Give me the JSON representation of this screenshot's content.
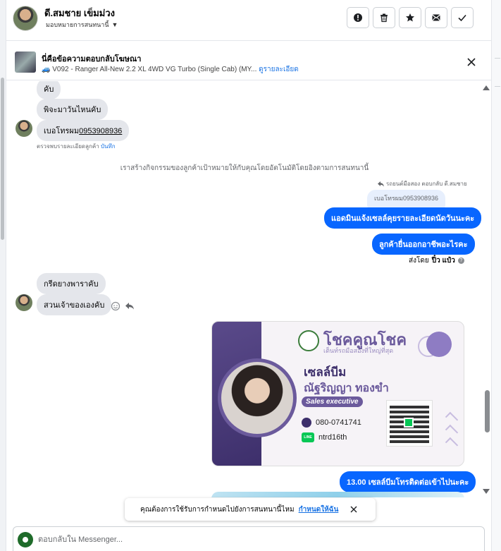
{
  "header": {
    "contact_name": "ดี.สมชาย เข็มม่วง",
    "assign_label": "มอบหมายการสนทนานี้",
    "actions": [
      "spam-icon",
      "trash-icon",
      "star-icon",
      "mark-unread-icon",
      "done-icon"
    ]
  },
  "ad_context": {
    "title": "นี่คือข้อความตอบกลับโฆษณา",
    "subtitle": "V092 - Ranger All-New 2.2 XL 4WD VG Turbo (Single Cab) (MY...",
    "details_link": "ดูรายละเอียด"
  },
  "thread": {
    "incoming": [
      {
        "text": "คับ"
      },
      {
        "text": "พิจะมาวันไหนคับ"
      },
      {
        "text_prefix": "เบอโทรผม",
        "phone": "0953908936"
      }
    ],
    "note": {
      "text": "ตรวจพบรายละเอียดลูกค้า",
      "link": "บันทึก"
    },
    "system_message": "เราสร้างกิจกรรมของลูกค้าเป้าหมายให้กับคุณโดยอัตโนมัติโดยอิงตามการสนทนานี้",
    "replied_note": "รถยนต์มือสอง ตอบกลับ ดี.สมชาย",
    "quoted_text": "เบอโทรผม0953908936",
    "outgoing": [
      {
        "text": "แอดมินแจ้งเซลล์คุยรายละเอียดนัดวันนะคะ"
      },
      {
        "text": "ลูกค้ายื่นออกอาชีพอะไรคะ"
      }
    ],
    "sent_by": {
      "prefix": "ส่งโดย",
      "name": "ปิ๋ว แป๋ว"
    },
    "incoming_2": [
      {
        "text": "กรีดยางพาราคับ"
      },
      {
        "text": "สวนเจ้าของเองคับ"
      }
    ],
    "card": {
      "brand": "โชคคูณโชค",
      "brand_sub": "เต็นท์รถมือสองที่ใหญ่ที่สุด",
      "nickname": "เซลล์บีม",
      "fullname": "ณัฐริญญา ทองขำ",
      "role": "Sales executive",
      "phone": "080-0741741",
      "line_id": "ntrd16th",
      "line_icon": "LINE"
    },
    "last_outgoing": "13.00  เซลล์บีมโทรติดต่อเข้าไปนะคะ"
  },
  "toast": {
    "text": "คุณต้องการใช้รับการกำหนดไปยังการสนทนานี้ไหม",
    "link": "กำหนดให้ฉัน"
  },
  "composer": {
    "placeholder": "ตอบกลับใน Messenger..."
  }
}
